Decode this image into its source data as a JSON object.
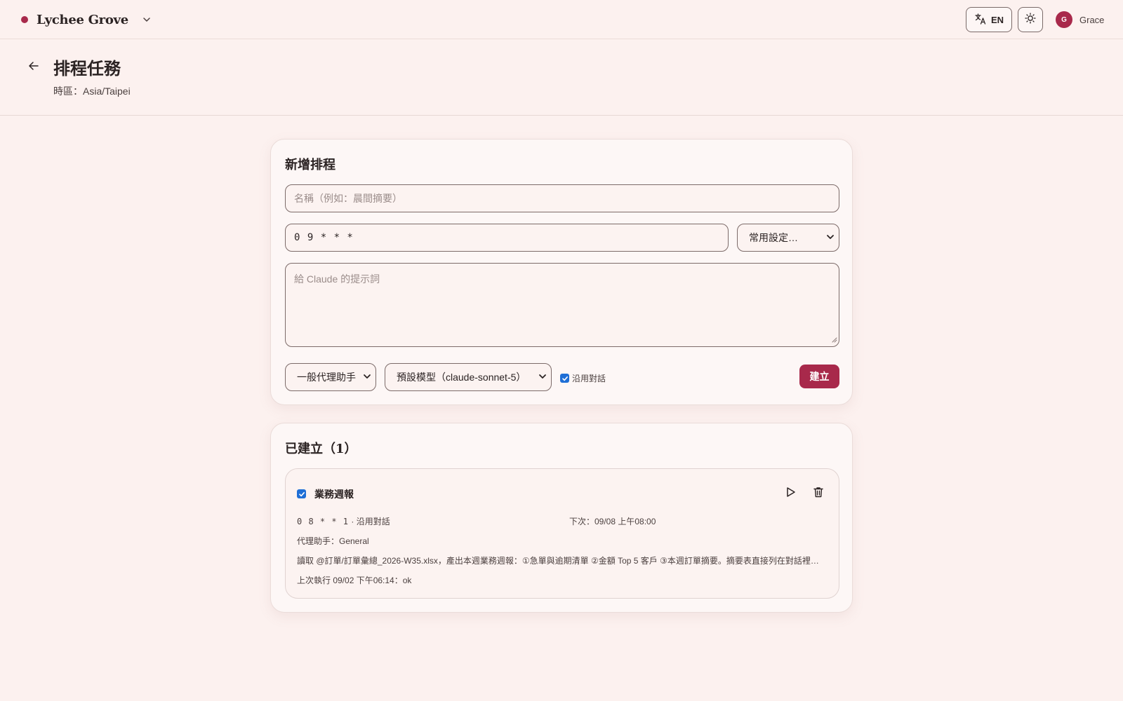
{
  "app": {
    "brand": "Lychee Grove",
    "language_label": "EN",
    "user": {
      "initial": "G",
      "name": "Grace"
    }
  },
  "page": {
    "title": "排程任務",
    "timezone": "時區：Asia/Taipei"
  },
  "create_card": {
    "title": "新增排程",
    "name_placeholder": "名稱（例如：晨間摘要）",
    "cron_value": "0 9 * * *",
    "preset_select": "常用設定…",
    "prompt_placeholder": "給 Claude 的提示詞",
    "agent_select": "一般代理助手",
    "model_select": "預設模型（claude-sonnet-5）",
    "continue_conversation_label": "沿用對話",
    "continue_conversation_checked": true,
    "create_button": "建立"
  },
  "list_card": {
    "title": "已建立（1）",
    "tasks": [
      {
        "enabled": true,
        "name": "業務週報",
        "cron": "0 8 * * 1",
        "mode": "· 沿用對話",
        "next_run": "下次：09/08 上午08:00",
        "agent": "代理助手：General",
        "prompt": "讀取 @訂單/訂單彙總_2026-W35.xlsx，產出本週業務週報：①急單與逾期清單 ②金額 Top 5 客戶 ③本週訂單摘要。摘要表直接列在對話裡，順便附上 CSV 檔案",
        "last_run": "上次執行 09/02 下午06:14：ok"
      }
    ]
  },
  "colors": {
    "accent": "#a8294b",
    "background": "#fcf1ef",
    "checkbox": "#1f6fd6"
  },
  "icons": {
    "language": "translate-icon",
    "theme": "sun-icon",
    "back": "arrow-left-icon",
    "run": "play-icon",
    "delete": "trash-icon"
  }
}
